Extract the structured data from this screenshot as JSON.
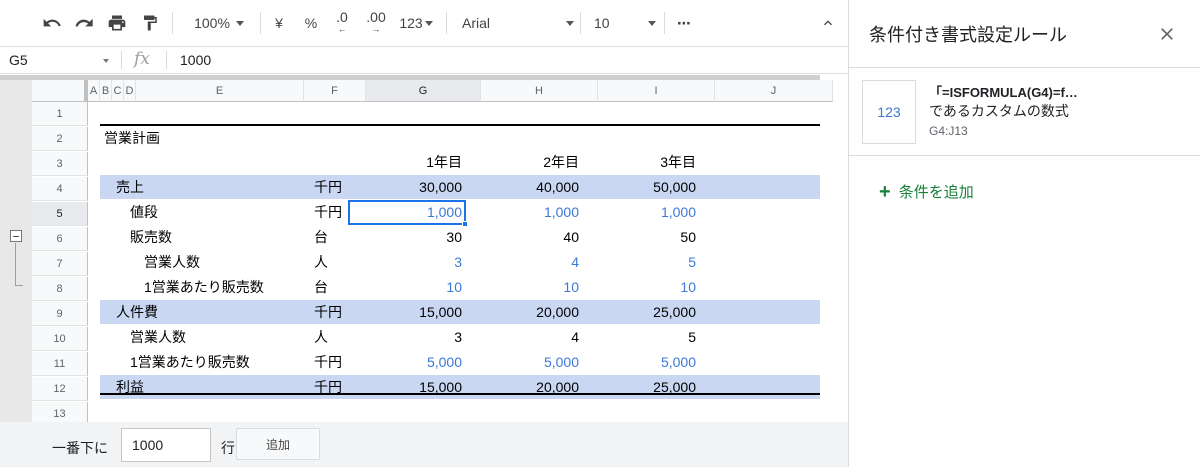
{
  "toolbar": {
    "zoom": "100%",
    "currency": "¥",
    "percent": "%",
    "decimal_decrease": ".0",
    "decimal_increase": ".00",
    "number_format": "123",
    "font": "Arial",
    "font_size": "10",
    "more": "⋯",
    "icons": [
      "undo-icon",
      "redo-icon",
      "print-icon",
      "paint-format-icon",
      "collapse-toolbar-icon"
    ]
  },
  "formula_bar": {
    "cell_ref": "G5",
    "fx": "fx",
    "value": "1000"
  },
  "grid": {
    "columns": [
      "A",
      "B",
      "C",
      "D",
      "E",
      "F",
      "G",
      "H",
      "I",
      "J"
    ],
    "selected_column": "G",
    "rows": [
      "1",
      "2",
      "3",
      "4",
      "5",
      "6",
      "7",
      "8",
      "9",
      "10",
      "11",
      "12",
      "13"
    ],
    "selected_row": "5",
    "title": "営業計画",
    "year_headers": [
      "1年目",
      "2年目",
      "3年目"
    ],
    "data_rows": [
      {
        "label": "売上",
        "unit": "千円",
        "values": [
          "30,000",
          "40,000",
          "50,000"
        ]
      },
      {
        "label": "値段",
        "unit": "千円",
        "values": [
          "1,000",
          "1,000",
          "1,000"
        ]
      },
      {
        "label": "販売数",
        "unit": "台",
        "values": [
          "30",
          "40",
          "50"
        ]
      },
      {
        "label": "営業人数",
        "unit": "人",
        "values": [
          "3",
          "4",
          "5"
        ]
      },
      {
        "label": "1営業あたり販売数",
        "unit": "台",
        "values": [
          "10",
          "10",
          "10"
        ]
      },
      {
        "label": "人件費",
        "unit": "千円",
        "values": [
          "15,000",
          "20,000",
          "25,000"
        ]
      },
      {
        "label": "営業人数",
        "unit": "人",
        "values": [
          "3",
          "4",
          "5"
        ]
      },
      {
        "label": "1営業あたり販売数",
        "unit": "千円",
        "values": [
          "5,000",
          "5,000",
          "5,000"
        ]
      },
      {
        "label": "利益",
        "unit": "千円",
        "values": [
          "15,000",
          "20,000",
          "25,000"
        ]
      }
    ],
    "colors": {
      "band": "#c9d7f3",
      "input_blue": "#3c78d8",
      "selection": "#1a73e8"
    }
  },
  "footer": {
    "label": "一番下に",
    "rows_value": "1000",
    "unit": "行",
    "add_button": "追加"
  },
  "panel": {
    "title": "条件付き書式設定ルール",
    "rule": {
      "preview": "123",
      "line1": "「=ISFORMULA(G4)=f…",
      "line2": "であるカスタムの数式",
      "range": "G4:J13"
    },
    "add_condition": "条件を追加",
    "accent": "#188038"
  }
}
